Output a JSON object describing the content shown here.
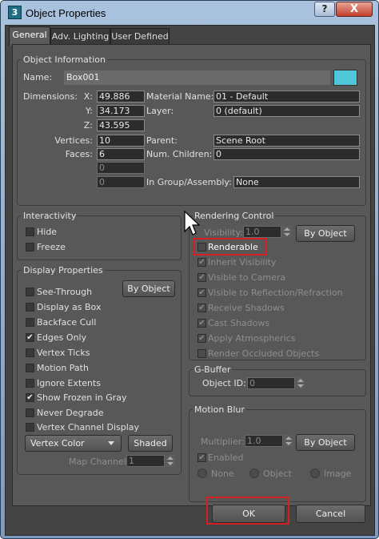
{
  "window": {
    "title": "Object Properties",
    "app_icon": "3",
    "minimize": "?",
    "close": "X"
  },
  "tabs": [
    "General",
    "Adv. Lighting",
    "User Defined"
  ],
  "object_info": {
    "title": "Object Information",
    "name_label": "Name:",
    "name_value": "Box001",
    "color": "#4fc7d9",
    "dim_label": "Dimensions:",
    "x_label": "X:",
    "x": "49.886",
    "y_label": "Y:",
    "y": "34.173",
    "z_label": "Z:",
    "z": "43.595",
    "vert_label": "Vertices:",
    "vertices": "10",
    "faces_label": "Faces:",
    "faces": "6",
    "blank1": "0",
    "blank2": "0",
    "mat_label": "Material Name:",
    "material": "01 - Default",
    "layer_label": "Layer:",
    "layer": "0 (default)",
    "parent_label": "Parent:",
    "parent": "Scene Root",
    "children_label": "Num. Children:",
    "children": "0",
    "group_label": "In Group/Assembly:",
    "group": "None"
  },
  "interactivity": {
    "title": "Interactivity",
    "hide": "Hide",
    "freeze": "Freeze"
  },
  "display": {
    "title": "Display Properties",
    "see_through": "See-Through",
    "display_box": "Display as Box",
    "backface": "Backface Cull",
    "edges_only": "Edges Only",
    "vertex_ticks": "Vertex Ticks",
    "motion_path": "Motion Path",
    "ignore_extents": "Ignore Extents",
    "show_frozen": "Show Frozen in Gray",
    "never_degrade": "Never Degrade",
    "vertex_channel": "Vertex Channel Display",
    "by_object": "By Object",
    "vertex_color": "Vertex Color",
    "shaded": "Shaded",
    "map_channel_label": "Map Channel:",
    "map_channel": "1"
  },
  "rendering": {
    "title": "Rendering Control",
    "visibility_label": "Visibility:",
    "visibility": "1.0",
    "by_object": "By Object",
    "renderable": "Renderable",
    "inherit": "Inherit Visibility",
    "vis_camera": "Visible to Camera",
    "vis_reflection": "Visible to Reflection/Refraction",
    "receive_shadows": "Receive Shadows",
    "cast_shadows": "Cast Shadows",
    "apply_atmos": "Apply Atmospherics",
    "render_occluded": "Render Occluded Objects"
  },
  "gbuffer": {
    "title": "G-Buffer",
    "object_id_label": "Object ID:",
    "object_id": "0"
  },
  "motion_blur": {
    "title": "Motion Blur",
    "multiplier_label": "Multiplier:",
    "multiplier": "1.0",
    "by_object": "By Object",
    "enabled": "Enabled",
    "none": "None",
    "object": "Object",
    "image": "Image"
  },
  "footer": {
    "ok": "OK",
    "cancel": "Cancel"
  },
  "checked_mark": "✔"
}
